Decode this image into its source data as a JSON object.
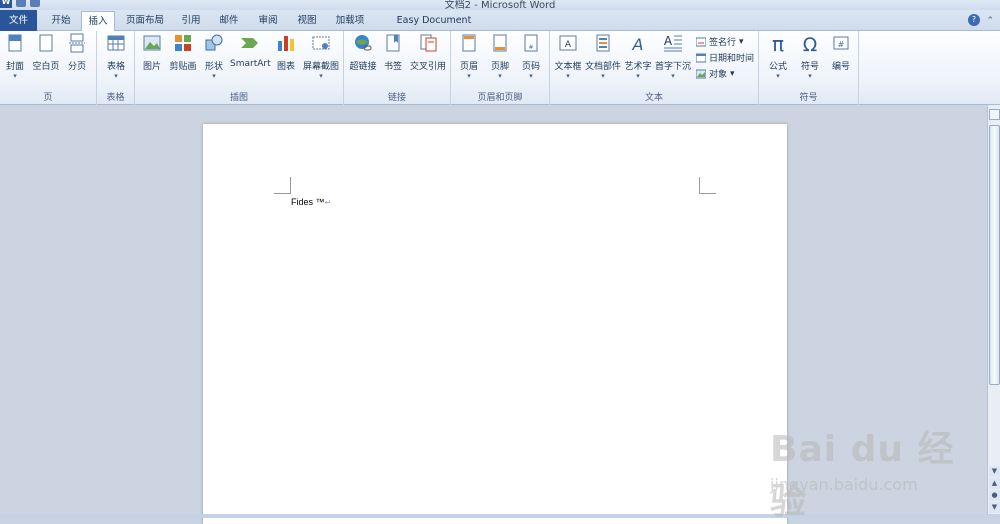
{
  "window": {
    "title": "文档2 - Microsoft Word"
  },
  "tabs": {
    "file": "文件",
    "items": [
      "开始",
      "插入",
      "页面布局",
      "引用",
      "邮件",
      "审阅",
      "视图",
      "加载项",
      "Easy Document Creator"
    ],
    "active": "插入"
  },
  "ribbon": {
    "groups": {
      "page": {
        "label": "页",
        "buttons": [
          "封面",
          "空白页",
          "分页"
        ]
      },
      "table": {
        "label": "表格",
        "buttons": [
          "表格"
        ]
      },
      "illustrations": {
        "label": "插图",
        "buttons": [
          "图片",
          "剪贴画",
          "形状",
          "SmartArt",
          "图表",
          "屏幕截图"
        ]
      },
      "links": {
        "label": "链接",
        "buttons": [
          "超链接",
          "书签",
          "交叉引用"
        ]
      },
      "header_footer": {
        "label": "页眉和页脚",
        "buttons": [
          "页眉",
          "页脚",
          "页码"
        ]
      },
      "text": {
        "label": "文本",
        "buttons": [
          "文本框",
          "文档部件",
          "艺术字",
          "首字下沉"
        ],
        "small_buttons": [
          "签名行",
          "日期和时间",
          "对象"
        ]
      },
      "symbols": {
        "label": "符号",
        "buttons": [
          "公式",
          "符号",
          "编号"
        ]
      }
    }
  },
  "document": {
    "text": "Fides ™"
  },
  "watermark": {
    "logo": "Bai du 经验",
    "url": "jingyan.baidu.com"
  },
  "colors": {
    "file_tab": "#2a5699",
    "page": "#ffffff",
    "workspace": "#ccd4e1"
  }
}
